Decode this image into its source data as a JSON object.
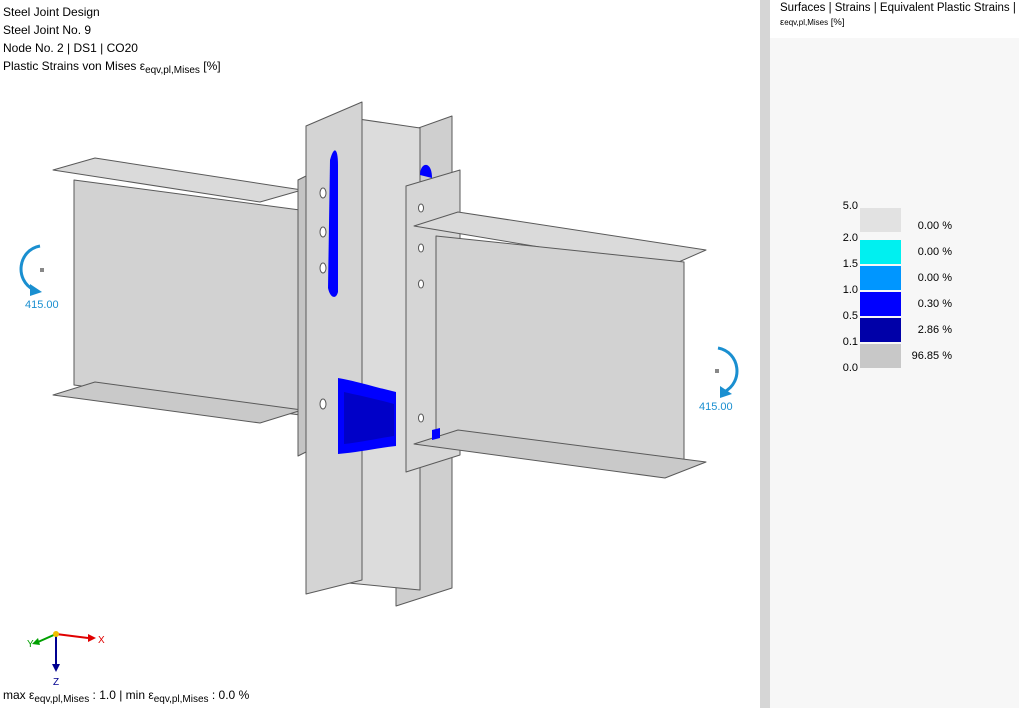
{
  "info": {
    "line1": "Steel Joint Design",
    "line2": "Steel Joint No. 9",
    "line3": "Node No. 2 | DS1 | CO20",
    "result_prefix": "Plastic Strains von Mises ε",
    "result_sub": "eqv,pl,Mises",
    "result_unit": " [%]"
  },
  "moments": {
    "left": "415.00",
    "right": "415.00"
  },
  "axes": {
    "x": "X",
    "y": "Y",
    "z": "Z"
  },
  "footer": {
    "max_prefix": "max ε",
    "max_sub": "eqv,pl,Mises",
    "max_value": " : 1.0 | min ε",
    "min_sub": "eqv,pl,Mises",
    "min_value": " : 0.0 %"
  },
  "panel": {
    "title": "Surfaces | Strains | Equivalent Plastic Strains |",
    "sub_prefix": "ε",
    "sub_sub": "eqv,pl,Mises",
    "sub_unit": " [%]"
  },
  "legend": {
    "values": [
      "5.0",
      "2.0",
      "1.5",
      "1.0",
      "0.5",
      "0.1",
      "0.0"
    ],
    "entries": [
      {
        "color": "#e2e2e2",
        "percent": "0.00 %"
      },
      {
        "color": "#00f0f0",
        "percent": "0.00 %"
      },
      {
        "color": "#0096ff",
        "percent": "0.00 %"
      },
      {
        "color": "#0000ff",
        "percent": "0.30 %"
      },
      {
        "color": "#0000a8",
        "percent": "2.86 %"
      },
      {
        "color": "#c8c8c8",
        "percent": "96.85 %"
      }
    ]
  },
  "colors": {
    "steel": "#d4d4d4",
    "edge": "#5a5a5a",
    "strain_high": "#0000ff",
    "moment_arrow": "#1a8fd0"
  }
}
